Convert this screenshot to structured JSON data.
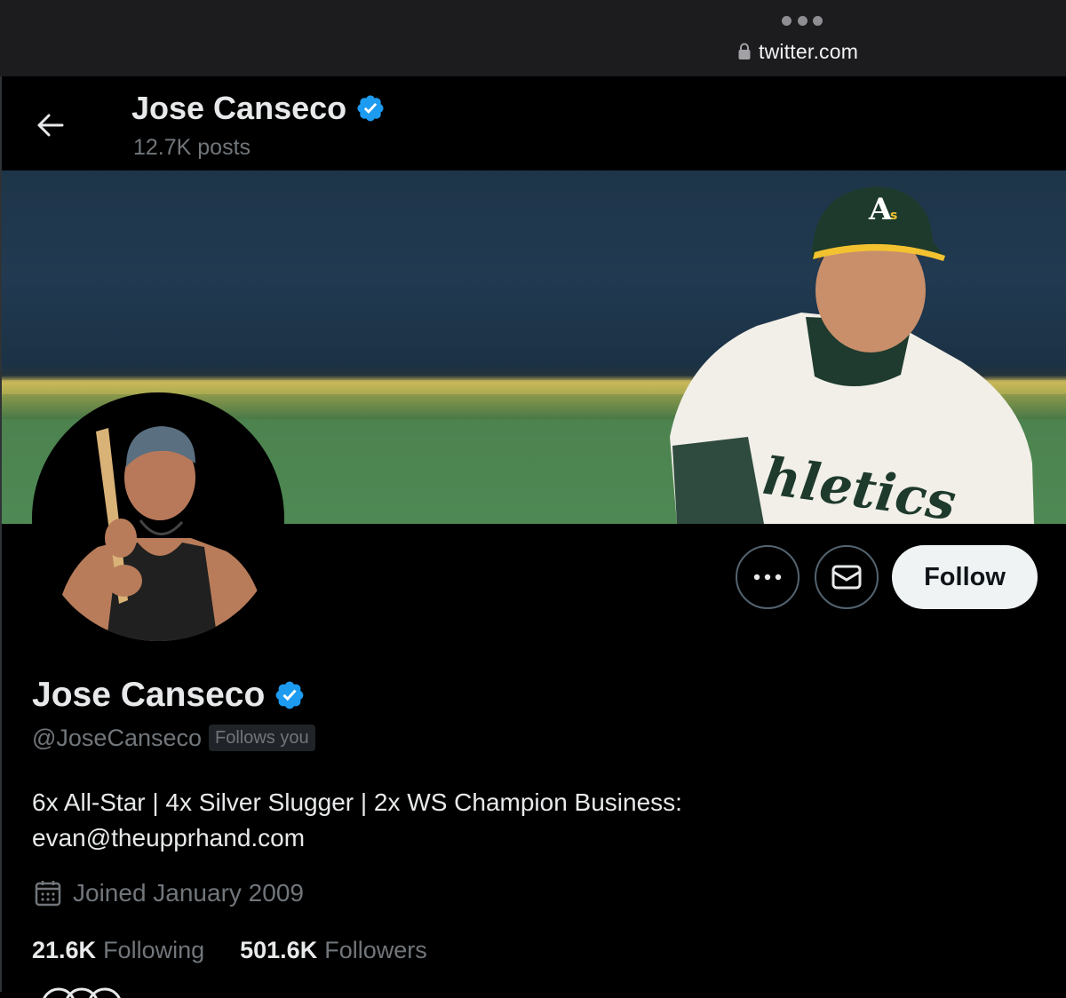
{
  "browser": {
    "url": "twitter.com",
    "menu_icon": "ellipsis-icon",
    "lock_icon": "lock-icon"
  },
  "header": {
    "name": "Jose Canseco",
    "posts": "12.7K posts",
    "back_icon": "arrow-left-icon"
  },
  "profile": {
    "name": "Jose Canseco",
    "verified": true,
    "handle": "@JoseCanseco",
    "follows_you": "Follows you",
    "bio": "6x All-Star | 4x Silver Slugger | 2x WS Champion Business: evan@theupprhand.com",
    "joined": "Joined January 2009",
    "following_count": "21.6K",
    "following_label": "Following",
    "followers_count": "501.6K",
    "followers_label": "Followers"
  },
  "actions": {
    "follow_label": "Follow",
    "more_icon": "ellipsis-icon",
    "message_icon": "envelope-icon"
  },
  "colors": {
    "background": "#000000",
    "text_primary": "#e7e9ea",
    "text_secondary": "#71767b",
    "verified_blue": "#1d9bf0",
    "follow_button_bg": "#eff3f4",
    "border": "#536471"
  }
}
